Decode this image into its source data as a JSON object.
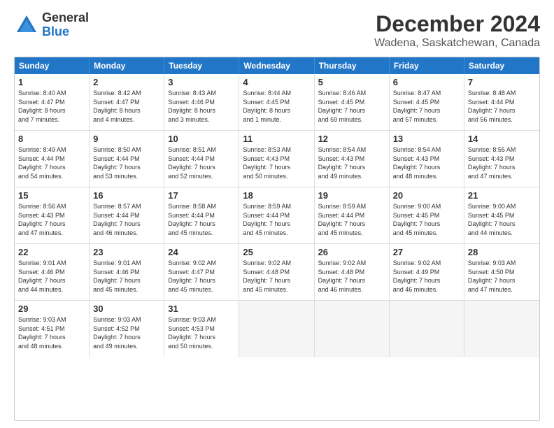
{
  "logo": {
    "general": "General",
    "blue": "Blue"
  },
  "title": "December 2024",
  "subtitle": "Wadena, Saskatchewan, Canada",
  "header_days": [
    "Sunday",
    "Monday",
    "Tuesday",
    "Wednesday",
    "Thursday",
    "Friday",
    "Saturday"
  ],
  "weeks": [
    [
      {
        "day": "1",
        "lines": [
          "Sunrise: 8:40 AM",
          "Sunset: 4:47 PM",
          "Daylight: 8 hours",
          "and 7 minutes."
        ]
      },
      {
        "day": "2",
        "lines": [
          "Sunrise: 8:42 AM",
          "Sunset: 4:47 PM",
          "Daylight: 8 hours",
          "and 4 minutes."
        ]
      },
      {
        "day": "3",
        "lines": [
          "Sunrise: 8:43 AM",
          "Sunset: 4:46 PM",
          "Daylight: 8 hours",
          "and 3 minutes."
        ]
      },
      {
        "day": "4",
        "lines": [
          "Sunrise: 8:44 AM",
          "Sunset: 4:45 PM",
          "Daylight: 8 hours",
          "and 1 minute."
        ]
      },
      {
        "day": "5",
        "lines": [
          "Sunrise: 8:46 AM",
          "Sunset: 4:45 PM",
          "Daylight: 7 hours",
          "and 59 minutes."
        ]
      },
      {
        "day": "6",
        "lines": [
          "Sunrise: 8:47 AM",
          "Sunset: 4:45 PM",
          "Daylight: 7 hours",
          "and 57 minutes."
        ]
      },
      {
        "day": "7",
        "lines": [
          "Sunrise: 8:48 AM",
          "Sunset: 4:44 PM",
          "Daylight: 7 hours",
          "and 56 minutes."
        ]
      }
    ],
    [
      {
        "day": "8",
        "lines": [
          "Sunrise: 8:49 AM",
          "Sunset: 4:44 PM",
          "Daylight: 7 hours",
          "and 54 minutes."
        ]
      },
      {
        "day": "9",
        "lines": [
          "Sunrise: 8:50 AM",
          "Sunset: 4:44 PM",
          "Daylight: 7 hours",
          "and 53 minutes."
        ]
      },
      {
        "day": "10",
        "lines": [
          "Sunrise: 8:51 AM",
          "Sunset: 4:44 PM",
          "Daylight: 7 hours",
          "and 52 minutes."
        ]
      },
      {
        "day": "11",
        "lines": [
          "Sunrise: 8:53 AM",
          "Sunset: 4:43 PM",
          "Daylight: 7 hours",
          "and 50 minutes."
        ]
      },
      {
        "day": "12",
        "lines": [
          "Sunrise: 8:54 AM",
          "Sunset: 4:43 PM",
          "Daylight: 7 hours",
          "and 49 minutes."
        ]
      },
      {
        "day": "13",
        "lines": [
          "Sunrise: 8:54 AM",
          "Sunset: 4:43 PM",
          "Daylight: 7 hours",
          "and 48 minutes."
        ]
      },
      {
        "day": "14",
        "lines": [
          "Sunrise: 8:55 AM",
          "Sunset: 4:43 PM",
          "Daylight: 7 hours",
          "and 47 minutes."
        ]
      }
    ],
    [
      {
        "day": "15",
        "lines": [
          "Sunrise: 8:56 AM",
          "Sunset: 4:43 PM",
          "Daylight: 7 hours",
          "and 47 minutes."
        ]
      },
      {
        "day": "16",
        "lines": [
          "Sunrise: 8:57 AM",
          "Sunset: 4:44 PM",
          "Daylight: 7 hours",
          "and 46 minutes."
        ]
      },
      {
        "day": "17",
        "lines": [
          "Sunrise: 8:58 AM",
          "Sunset: 4:44 PM",
          "Daylight: 7 hours",
          "and 45 minutes."
        ]
      },
      {
        "day": "18",
        "lines": [
          "Sunrise: 8:59 AM",
          "Sunset: 4:44 PM",
          "Daylight: 7 hours",
          "and 45 minutes."
        ]
      },
      {
        "day": "19",
        "lines": [
          "Sunrise: 8:59 AM",
          "Sunset: 4:44 PM",
          "Daylight: 7 hours",
          "and 45 minutes."
        ]
      },
      {
        "day": "20",
        "lines": [
          "Sunrise: 9:00 AM",
          "Sunset: 4:45 PM",
          "Daylight: 7 hours",
          "and 45 minutes."
        ]
      },
      {
        "day": "21",
        "lines": [
          "Sunrise: 9:00 AM",
          "Sunset: 4:45 PM",
          "Daylight: 7 hours",
          "and 44 minutes."
        ]
      }
    ],
    [
      {
        "day": "22",
        "lines": [
          "Sunrise: 9:01 AM",
          "Sunset: 4:46 PM",
          "Daylight: 7 hours",
          "and 44 minutes."
        ]
      },
      {
        "day": "23",
        "lines": [
          "Sunrise: 9:01 AM",
          "Sunset: 4:46 PM",
          "Daylight: 7 hours",
          "and 45 minutes."
        ]
      },
      {
        "day": "24",
        "lines": [
          "Sunrise: 9:02 AM",
          "Sunset: 4:47 PM",
          "Daylight: 7 hours",
          "and 45 minutes."
        ]
      },
      {
        "day": "25",
        "lines": [
          "Sunrise: 9:02 AM",
          "Sunset: 4:48 PM",
          "Daylight: 7 hours",
          "and 45 minutes."
        ]
      },
      {
        "day": "26",
        "lines": [
          "Sunrise: 9:02 AM",
          "Sunset: 4:48 PM",
          "Daylight: 7 hours",
          "and 46 minutes."
        ]
      },
      {
        "day": "27",
        "lines": [
          "Sunrise: 9:02 AM",
          "Sunset: 4:49 PM",
          "Daylight: 7 hours",
          "and 46 minutes."
        ]
      },
      {
        "day": "28",
        "lines": [
          "Sunrise: 9:03 AM",
          "Sunset: 4:50 PM",
          "Daylight: 7 hours",
          "and 47 minutes."
        ]
      }
    ],
    [
      {
        "day": "29",
        "lines": [
          "Sunrise: 9:03 AM",
          "Sunset: 4:51 PM",
          "Daylight: 7 hours",
          "and 48 minutes."
        ]
      },
      {
        "day": "30",
        "lines": [
          "Sunrise: 9:03 AM",
          "Sunset: 4:52 PM",
          "Daylight: 7 hours",
          "and 49 minutes."
        ]
      },
      {
        "day": "31",
        "lines": [
          "Sunrise: 9:03 AM",
          "Sunset: 4:53 PM",
          "Daylight: 7 hours",
          "and 50 minutes."
        ]
      },
      {
        "day": "",
        "lines": []
      },
      {
        "day": "",
        "lines": []
      },
      {
        "day": "",
        "lines": []
      },
      {
        "day": "",
        "lines": []
      }
    ]
  ]
}
